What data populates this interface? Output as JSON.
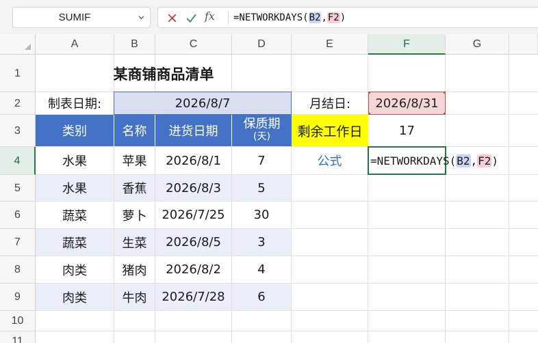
{
  "toolbar": {
    "name_box": "SUMIF",
    "cancel_icon": "close-icon",
    "confirm_icon": "check-icon",
    "fx_label": "fx",
    "formula": {
      "prefix": "=NETWORKDAYS(",
      "ref1": "B2",
      "sep": ",",
      "ref2": "F2",
      "suffix": ")"
    }
  },
  "columns": [
    "A",
    "B",
    "C",
    "D",
    "E",
    "F",
    "G"
  ],
  "rows": [
    "1",
    "2",
    "3",
    "4",
    "5",
    "6",
    "7",
    "8",
    "9",
    "10",
    "11"
  ],
  "sheet": {
    "title": "某商铺商品清单",
    "date_label": "制表日期:",
    "date_value": "2026/8/7",
    "month_end_label": "月结日:",
    "month_end_value": "2026/8/31",
    "remaining_label": "剩余工作日",
    "remaining_value": "17",
    "formula_label": "公式",
    "headers": {
      "category": "类别",
      "name": "名称",
      "purchase_date": "进货日期",
      "shelf_life": "保质期",
      "shelf_life_unit": "(天)"
    },
    "items": [
      {
        "category": "水果",
        "name": "苹果",
        "date": "2026/8/1",
        "days": "7"
      },
      {
        "category": "水果",
        "name": "香蕉",
        "date": "2026/8/3",
        "days": "5"
      },
      {
        "category": "蔬菜",
        "name": "萝卜",
        "date": "2026/7/25",
        "days": "30"
      },
      {
        "category": "蔬菜",
        "name": "生菜",
        "date": "2026/8/5",
        "days": "3"
      },
      {
        "category": "肉类",
        "name": "猪肉",
        "date": "2026/8/2",
        "days": "4"
      },
      {
        "category": "肉类",
        "name": "牛肉",
        "date": "2026/7/28",
        "days": "6"
      }
    ]
  },
  "colors": {
    "header_fill": "#4472c4",
    "band_fill": "#e9eef8",
    "highlight_yellow": "#ffff00",
    "ref1_fill": "#c9d3f2",
    "ref2_fill": "#f6cdd0",
    "active_green": "#1f7a43"
  }
}
